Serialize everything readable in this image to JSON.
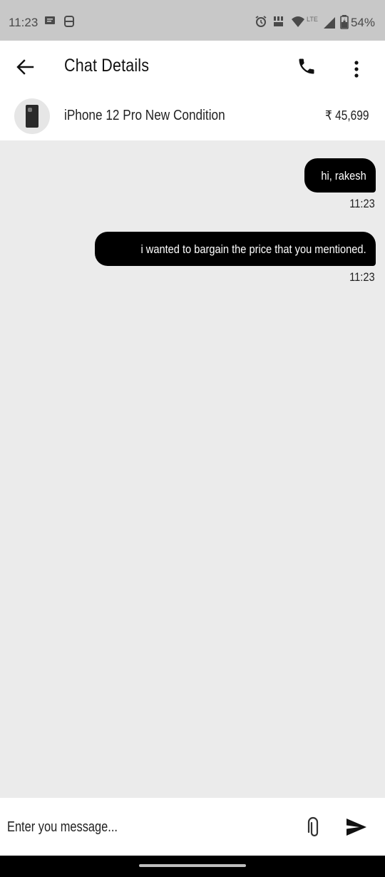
{
  "status_bar": {
    "time": "11:23",
    "battery": "54%",
    "icons": [
      "message-icon",
      "sync-icon",
      "alarm-icon",
      "volte-icon",
      "wifi-icon",
      "lte-signal-icon",
      "battery-icon"
    ]
  },
  "header": {
    "title": "Chat Details",
    "back_icon": "arrow-left-icon",
    "call_icon": "phone-icon",
    "more_icon": "more-vertical-icon"
  },
  "product": {
    "name": "iPhone 12 Pro New Condition",
    "price": "₹ 45,699"
  },
  "messages": [
    {
      "text": "hi, rakesh",
      "time": "11:23"
    },
    {
      "text": "i wanted to bargain the price that you mentioned.",
      "time": "11:23"
    }
  ],
  "composer": {
    "placeholder": "Enter you message...",
    "value": ""
  },
  "colors": {
    "status_bar_bg": "#c8c8c8",
    "chat_bg": "#ebebeb",
    "bubble_bg": "#000000",
    "bubble_text": "#ffffff"
  }
}
